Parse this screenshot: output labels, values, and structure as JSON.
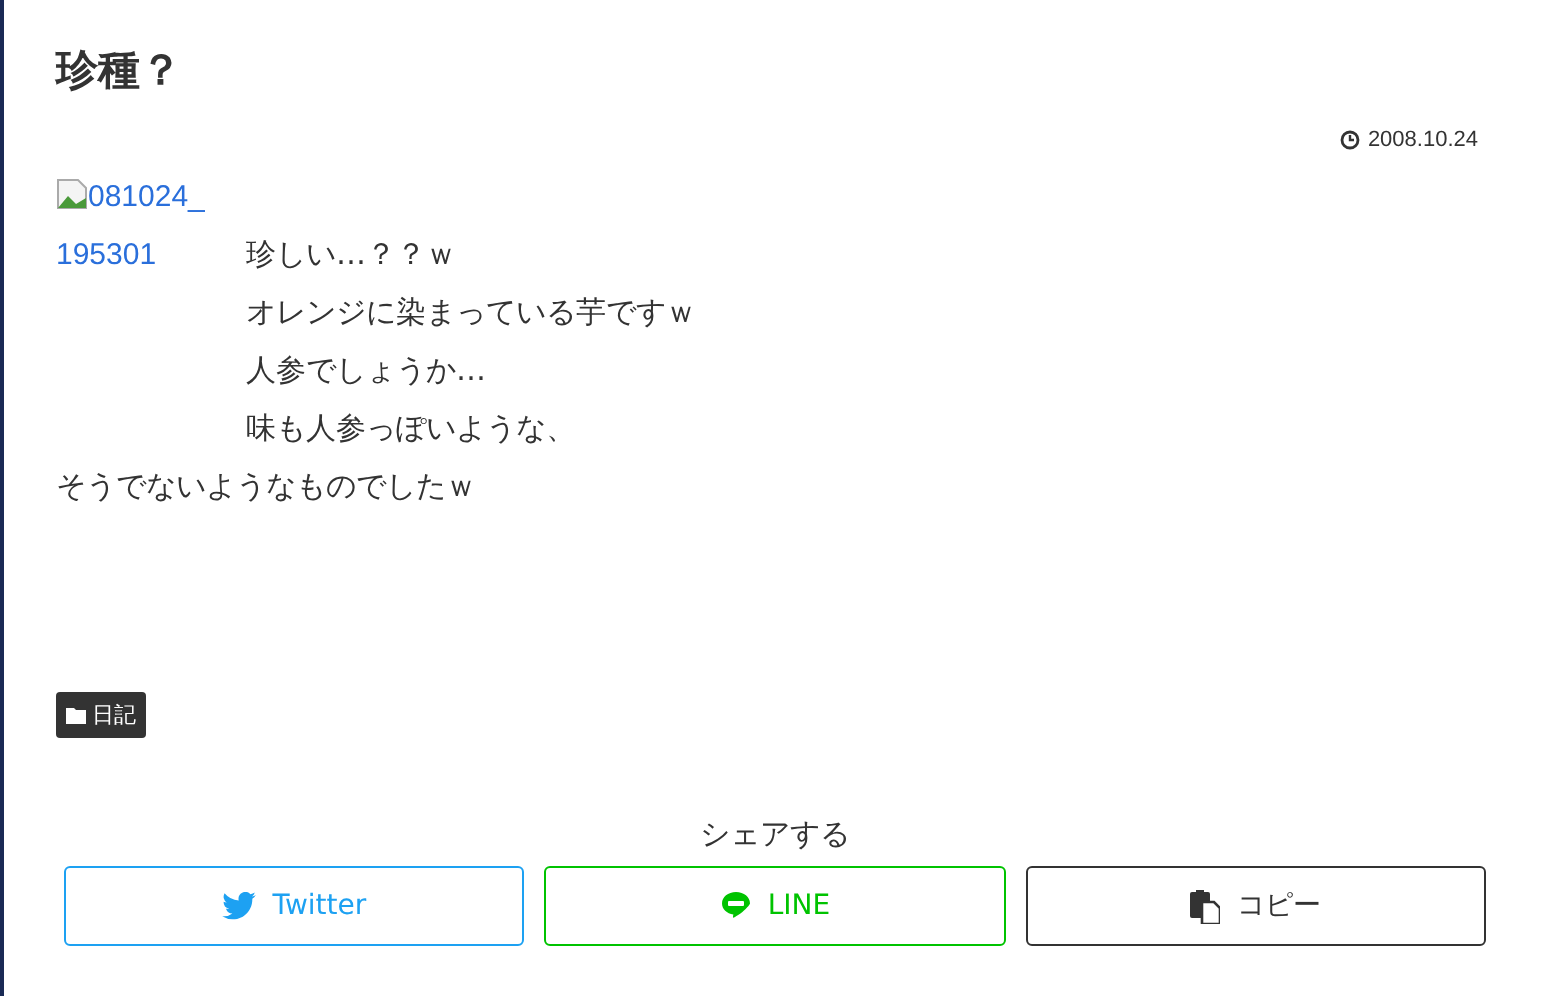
{
  "title": "珍種？",
  "date": "2008.10.24",
  "image_link": "081024_195301",
  "body_lines": [
    "珍しい…？？ｗ",
    "オレンジに染まっている芋ですｗ",
    "人参でしょうか…",
    "味も人参っぽいような、"
  ],
  "body_last": "そうでないようなものでしたｗ",
  "category": "日記",
  "share_heading": "シェアする",
  "share_buttons": [
    {
      "kind": "twitter",
      "label": "Twitter"
    },
    {
      "kind": "line",
      "label": "LINE"
    },
    {
      "kind": "copy",
      "label": "コピー"
    }
  ]
}
